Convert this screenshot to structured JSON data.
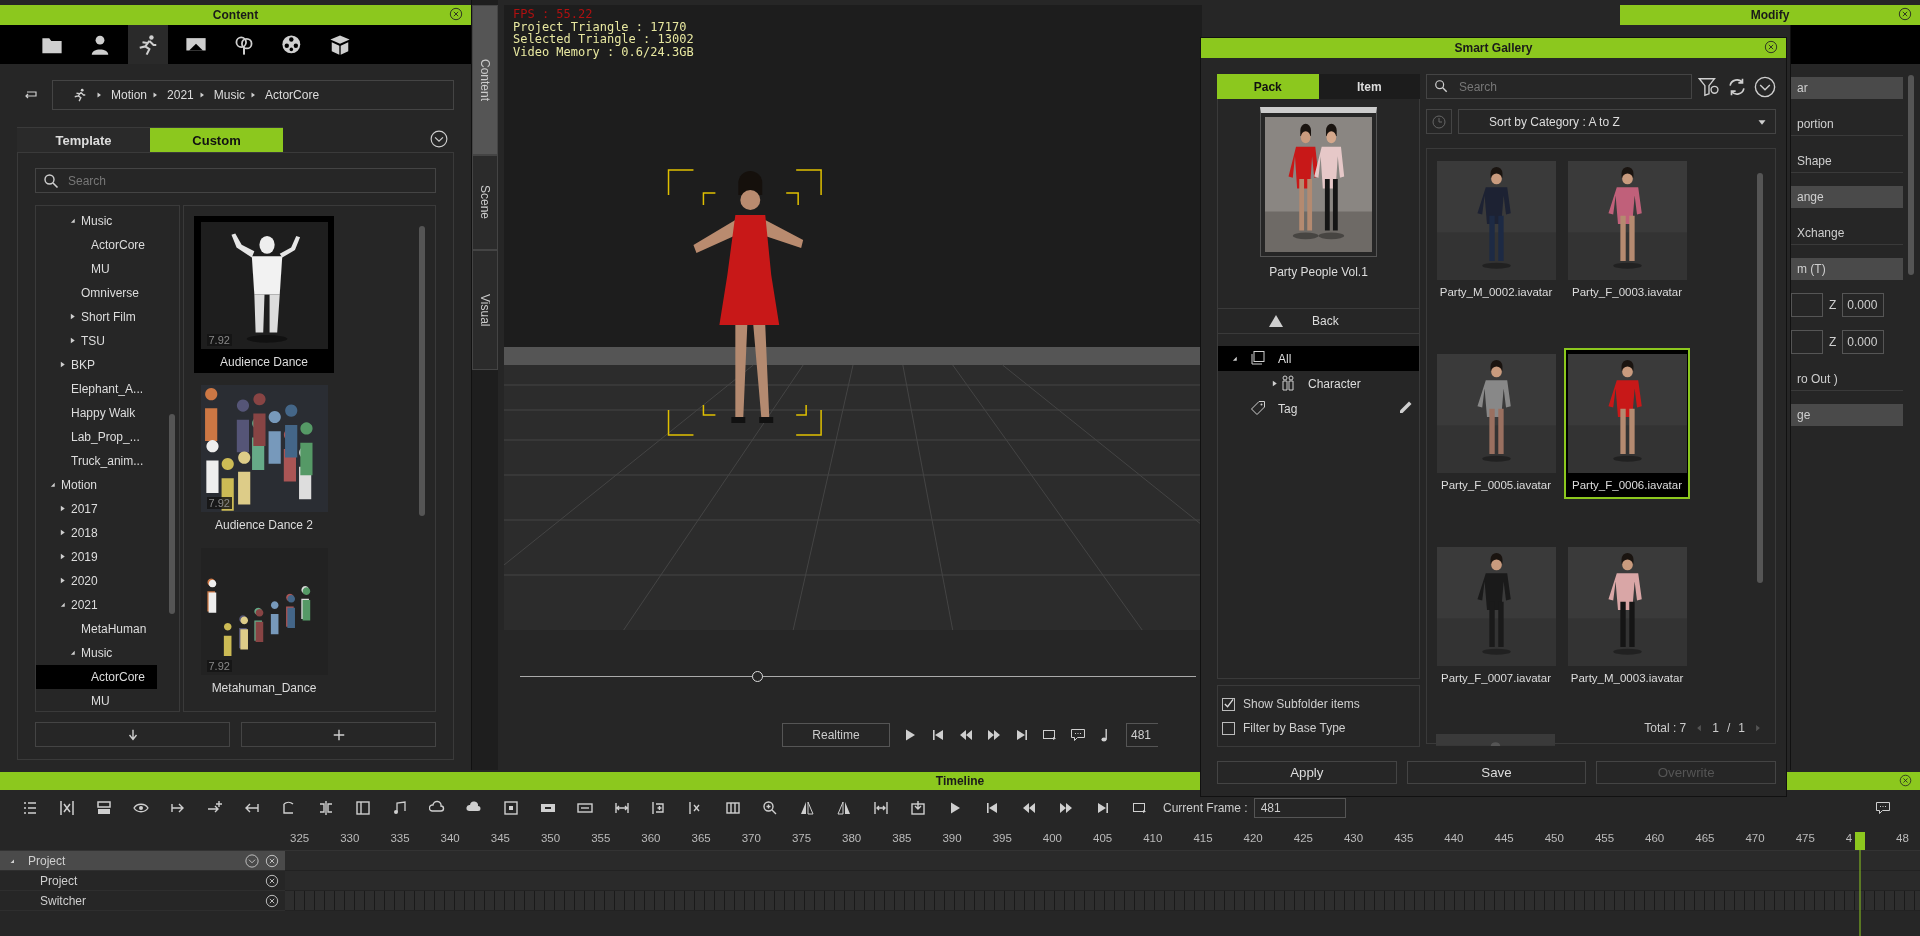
{
  "content": {
    "title": "Content",
    "icon_tabs": [
      {
        "kind": "folder",
        "selected": false
      },
      {
        "kind": "person",
        "selected": false
      },
      {
        "kind": "runner",
        "selected": true
      },
      {
        "kind": "stage",
        "selected": false
      },
      {
        "kind": "tree",
        "selected": false
      },
      {
        "kind": "reel",
        "selected": false
      },
      {
        "kind": "box",
        "selected": false
      }
    ],
    "breadcrumb": [
      "Motion",
      "2021",
      "Music",
      "ActorCore"
    ],
    "tabs": [
      {
        "label": "Template",
        "selected": false
      },
      {
        "label": "Custom",
        "selected": true
      }
    ],
    "search": {
      "placeholder": "Search"
    },
    "tree": [
      {
        "children": [
          {
            "children": [
              {
                "label": "Music",
                "expanded": true,
                "selected": false,
                "children": [
                  {
                    "label": "ActorCore",
                    "selected": false
                  },
                  {
                    "label": "MU",
                    "selected": false
                  }
                ]
              },
              {
                "label": "Omniverse",
                "selected": false
              },
              {
                "label": "Short Film",
                "expanded": false,
                "selected": false
              },
              {
                "label": "TSU",
                "expanded": false,
                "selected": false
              }
            ]
          },
          {
            "label": "BKP",
            "expanded": false,
            "selected": false
          },
          {
            "label": "Elephant_A...",
            "selected": false
          },
          {
            "label": "Happy Walk",
            "selected": false
          },
          {
            "label": "Lab_Prop_...",
            "selected": false
          },
          {
            "label": "Truck_anim...",
            "selected": false
          }
        ]
      },
      {
        "label": "Motion",
        "expanded": true,
        "selected": false,
        "children": [
          {
            "label": "2017",
            "expanded": false,
            "selected": false
          },
          {
            "label": "2018",
            "expanded": false,
            "selected": false
          },
          {
            "label": "2019",
            "expanded": false,
            "selected": false
          },
          {
            "label": "2020",
            "expanded": false,
            "selected": false
          },
          {
            "label": "2021",
            "expanded": true,
            "selected": false,
            "children": [
              {
                "label": "MetaHuman",
                "selected": false
              },
              {
                "label": "Music",
                "expanded": true,
                "selected": false,
                "children": [
                  {
                    "label": "ActorCore",
                    "selected": true
                  },
                  {
                    "label": "MU",
                    "selected": false
                  }
                ]
              }
            ]
          }
        ]
      }
    ],
    "tiles": [
      {
        "label": "Audience Dance",
        "version": "7.92",
        "selected": true
      },
      {
        "label": "Audience Dance 2",
        "version": "7.92",
        "selected": false
      },
      {
        "label": "Metahuman_Dance",
        "version": "7.92",
        "selected": false
      }
    ]
  },
  "side_tabs": [
    {
      "label": "Content",
      "selected": true
    },
    {
      "label": "Scene",
      "selected": false
    },
    {
      "label": "Visual",
      "selected": false
    }
  ],
  "viewport": {
    "stats": [
      {
        "text": "FPS : 55.22",
        "kind": "fps"
      },
      {
        "text": "Project Triangle : 17170",
        "kind": "info"
      },
      {
        "text": "Selected Triangle : 13002",
        "kind": "info"
      },
      {
        "text": "Video Memory : 0.6/24.3GB",
        "kind": "info"
      }
    ],
    "slider": {
      "level": 0.35
    },
    "realtime": "Realtime",
    "frame": "481"
  },
  "modify": {
    "title": "Modify",
    "rows": [
      {
        "kind": "header",
        "text": "ar"
      },
      {
        "kind": "label",
        "text": "portion"
      },
      {
        "kind": "label",
        "text": "Shape"
      },
      {
        "kind": "header",
        "text": "ange"
      },
      {
        "kind": "label",
        "text": "Xchange"
      },
      {
        "kind": "header",
        "text": "m  (T)"
      },
      {
        "kind": "xyz",
        "axis": "Z",
        "value": "0.000"
      },
      {
        "kind": "xyz",
        "axis": "Z",
        "value": "0.000"
      },
      {
        "kind": "label",
        "text": "ro Out )"
      },
      {
        "kind": "header",
        "text": "ge"
      }
    ]
  },
  "gallery": {
    "title": "Smart Gallery",
    "tabs": [
      {
        "label": "Pack",
        "selected": true
      },
      {
        "label": "Item",
        "selected": false
      }
    ],
    "search": {
      "placeholder": "Search"
    },
    "sort": "Sort by Category : A to Z",
    "pack": {
      "label": "Party People Vol.1"
    },
    "back": "Back",
    "tree": [
      {
        "label": "All",
        "kind": "all",
        "expanded": true,
        "selected": true,
        "children": [
          {
            "label": "Character",
            "kind": "character",
            "expanded": false,
            "selected": false
          }
        ]
      },
      {
        "label": "Tag",
        "kind": "tag",
        "selected": false
      }
    ],
    "options": [
      {
        "label": "Show Subfolder items",
        "checked": true
      },
      {
        "label": "Filter by Base Type",
        "checked": false
      }
    ],
    "items": [
      {
        "label": "Party_M_0002.iavatar",
        "selected": false
      },
      {
        "label": "Party_F_0003.iavatar",
        "selected": false
      },
      {
        "label": "Party_F_0005.iavatar",
        "selected": false
      },
      {
        "label": "Party_F_0006.iavatar",
        "selected": true
      },
      {
        "label": "Party_F_0007.iavatar",
        "selected": false
      },
      {
        "label": "Party_M_0003.iavatar",
        "selected": false
      }
    ],
    "total": "Total : 7",
    "page": "1",
    "separator": "/",
    "pages": "1",
    "buttons": [
      {
        "label": "Apply",
        "disabled": false
      },
      {
        "label": "Save",
        "disabled": false
      },
      {
        "label": "Overwrite",
        "disabled": true
      }
    ]
  },
  "timeline": {
    "title": "Timeline",
    "current_frame_label": "Current Frame :",
    "current_frame": "481",
    "ruler": [
      "325",
      "330",
      "335",
      "340",
      "345",
      "350",
      "355",
      "360",
      "365",
      "370",
      "375",
      "380",
      "385",
      "390",
      "395",
      "400",
      "405",
      "410",
      "415",
      "420",
      "425",
      "430",
      "435",
      "440",
      "445",
      "450",
      "455",
      "460",
      "465",
      "470",
      "475",
      "4",
      "48"
    ],
    "tracks": [
      {
        "label": "Project",
        "expanded": true,
        "children": [
          {
            "label": "Project"
          },
          {
            "label": "Switcher"
          }
        ]
      }
    ]
  }
}
